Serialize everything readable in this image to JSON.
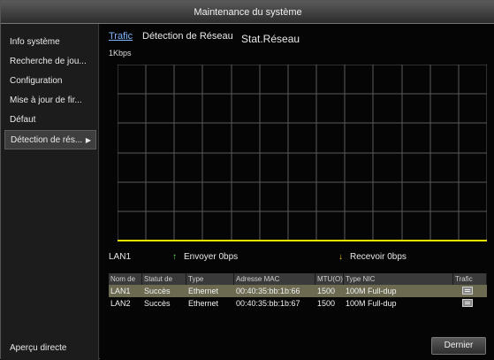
{
  "window": {
    "title": "Maintenance du système"
  },
  "sidebar": {
    "items": [
      {
        "label": "Info système"
      },
      {
        "label": "Recherche de jou..."
      },
      {
        "label": "Configuration"
      },
      {
        "label": "Mise à jour de fir..."
      },
      {
        "label": "Défaut"
      },
      {
        "label": "Détection de rés...",
        "active": true
      }
    ],
    "bottom_label": "Aperçu directe"
  },
  "tabs": [
    {
      "label": "Trafic",
      "active": true
    },
    {
      "label": "Détection de Réseau"
    },
    {
      "label": "Stat.Réseau"
    }
  ],
  "graph": {
    "rate_label": "1Kbps",
    "line_color": "#e6e600"
  },
  "legend": {
    "interface": "LAN1",
    "send": {
      "label": "Envoyer 0bps",
      "color": "#5fd85f"
    },
    "receive": {
      "label": "Recevoir 0bps",
      "color": "#f0c020"
    }
  },
  "table": {
    "headers": [
      "Nom de",
      "Statut de",
      "Type",
      "Adresse MAC",
      "MTU(O)",
      "Type NIC",
      "Trafic"
    ],
    "rows": [
      {
        "name": "LAN1",
        "status": "Succès",
        "type": "Ethernet",
        "mac": "00:40:35:bb:1b:66",
        "mtu": "1500",
        "nic": "100M Full-dup",
        "selected": true
      },
      {
        "name": "LAN2",
        "status": "Succès",
        "type": "Ethernet",
        "mac": "00:40:35:bb:1b:67",
        "mtu": "1500",
        "nic": "100M Full-dup",
        "selected": false
      }
    ]
  },
  "buttons": {
    "back_label": "Dernier"
  }
}
